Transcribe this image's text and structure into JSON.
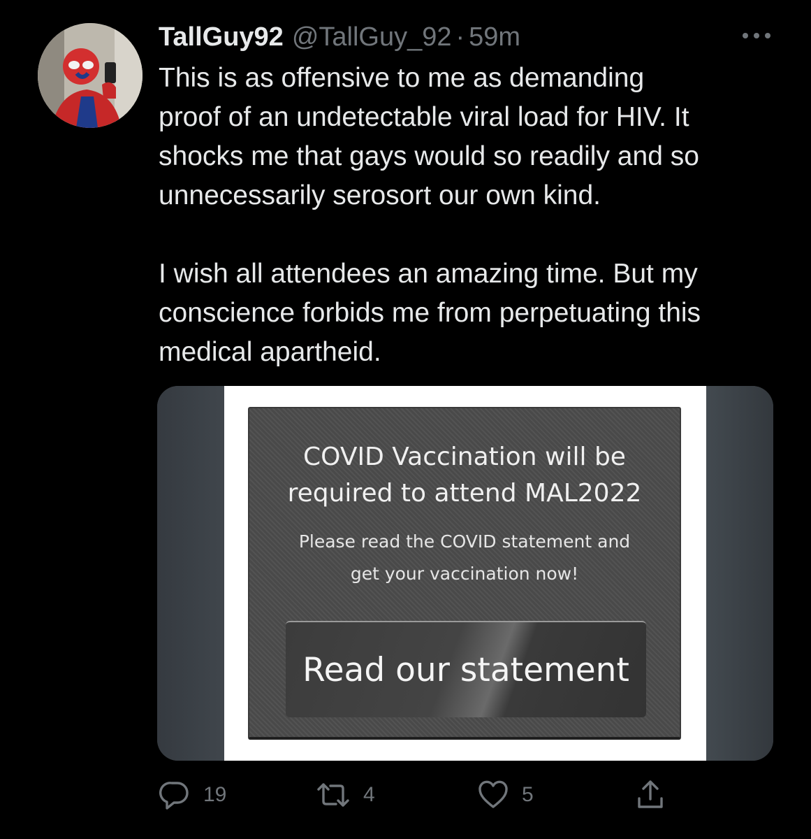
{
  "tweet": {
    "display_name": "TallGuy92",
    "handle": "@TallGuy_92",
    "separator": "·",
    "time": "59m",
    "text": "This is as offensive to me as demanding\nproof of an undetectable viral load for HIV. It\nshocks me that gays would so readily and so\nunnecessarily serosort our own kind.\n\nI wish all attendees an amazing time. But my\nconscience forbids me from perpetuating this\nmedical apartheid.",
    "media": {
      "headline": "COVID Vaccination will be\nrequired to attend MAL2022",
      "subtext": "Please read the COVID statement and\nget your vaccination now!",
      "button_label": "Read our statement"
    },
    "actions": {
      "reply_count": "19",
      "retweet_count": "4",
      "like_count": "5"
    }
  },
  "icons": {
    "more": "more-dots-icon",
    "reply": "reply-bubble-icon",
    "retweet": "retweet-icon",
    "like": "heart-icon",
    "share": "share-icon"
  },
  "colors": {
    "background": "#000000",
    "primary_text": "#e7e9ea",
    "secondary_text": "#71767b"
  }
}
